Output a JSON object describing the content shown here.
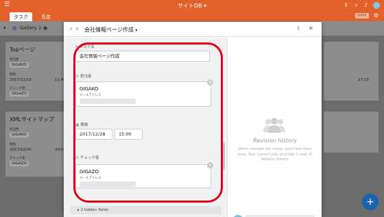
{
  "app": {
    "title": "サイトDB",
    "title_caret": "▾",
    "menu_icon": "hamburger-icon"
  },
  "tabs": [
    {
      "label": "タスク",
      "active": true
    },
    {
      "label": "氏名",
      "active": false
    }
  ],
  "badge": "SMAR",
  "viewbar": {
    "view_name": "Gallery 2"
  },
  "cards": [
    {
      "title": "Topページ",
      "label1": "担当者",
      "chip1": "GIGAKO",
      "label2": "期限",
      "date": "2017/12/19",
      "time": "11:4",
      "label3": "チェック者",
      "chip2": "GIGAZO"
    },
    {
      "title": "XMLサイトマップ",
      "label1": "担当者",
      "chip1": "GIGAKO",
      "label2": "期限",
      "date": "2017/12/20",
      "time": "20:0",
      "label3": "チェック者",
      "chip2": "GIGAZO"
    }
  ],
  "right_card_time": "17:10",
  "modal": {
    "title": "会社情報ページ作成",
    "title_caret": "▾",
    "fields": {
      "task_name": {
        "label": "タスク名",
        "value": "会社情報ページ作成"
      },
      "assignee": {
        "label": "担当者",
        "name": "GIGAKO",
        "sub": "メールアドレス"
      },
      "due": {
        "label": "期限",
        "date": "2017/12/28",
        "time": "15:00"
      },
      "checker": {
        "label": "チェック者",
        "name": "GIGAZO",
        "sub": "メールアドレス"
      }
    },
    "hidden_fields": "2 hidden fields",
    "revision": {
      "title": "Revision history",
      "desc": "When changes are made, you'll see them here. Your current plan provides 1 year of revision history."
    }
  },
  "fab_label": "+",
  "colors": {
    "brand": "#e3612b",
    "highlight": "#e3001b",
    "fab": "#1b63b0"
  }
}
